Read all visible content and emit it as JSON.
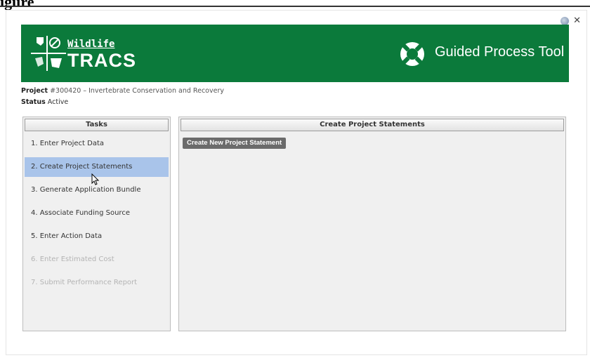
{
  "page_label": "igure",
  "banner": {
    "logo_top": "Wildlife",
    "logo_bottom": "TRACS",
    "tool_title": "Guided Process Tool",
    "color": "#0b7a3b"
  },
  "project": {
    "label": "Project",
    "value": "#300420 – Invertebrate Conservation and Recovery",
    "status_label": "Status",
    "status_value": "Active"
  },
  "tasks": {
    "header": "Tasks",
    "items": [
      {
        "label": "1. Enter Project Data",
        "state": "enabled"
      },
      {
        "label": "2. Create Project Statements",
        "state": "active"
      },
      {
        "label": "3. Generate Application Bundle",
        "state": "enabled"
      },
      {
        "label": "4. Associate Funding Source",
        "state": "enabled"
      },
      {
        "label": "5. Enter Action Data",
        "state": "enabled"
      },
      {
        "label": "6. Enter Estimated Cost",
        "state": "disabled"
      },
      {
        "label": "7. Submit Performance Report",
        "state": "disabled"
      }
    ]
  },
  "main": {
    "header": "Create Project Statements",
    "create_button": "Create New Project Statement"
  },
  "icons": {
    "help": "help-icon",
    "close": "close-icon",
    "lifebuoy": "lifebuoy-icon",
    "logo": "wildlife-tracs-logo"
  },
  "colors": {
    "active_task": "#a9c4ea",
    "button": "#6b6b6b"
  }
}
